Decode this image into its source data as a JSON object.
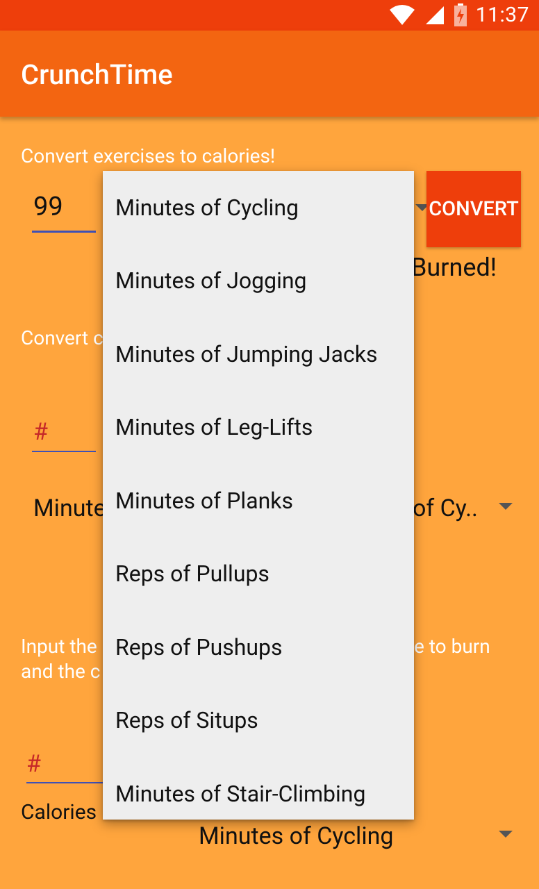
{
  "status": {
    "time": "11:37"
  },
  "app": {
    "title": "CrunchTime"
  },
  "section1": {
    "heading": "Convert exercises to calories!",
    "quantity_value": "99",
    "convert_label": "CONVERT",
    "result_partial": "Burned!"
  },
  "section2": {
    "heading_partial": "Convert c",
    "quantity_hint": "#",
    "spinner_left_partial": "Minute",
    "spinner_right_partial": "of Cy.."
  },
  "section3": {
    "line1_left": "Input the",
    "line1_right": "e to burn",
    "line2_left": "and the c",
    "quantity_hint": "#",
    "calories_label_partial": "Calories",
    "spinner_value": "Minutes of Cycling"
  },
  "dropdown": {
    "items": [
      "Minutes of Cycling",
      "Minutes of Jogging",
      "Minutes of Jumping Jacks",
      "Minutes of Leg-Lifts",
      "Minutes of Planks",
      "Reps of Pullups",
      "Reps of Pushups",
      "Reps of Situps",
      "Minutes of Stair-Climbing"
    ]
  },
  "colors": {
    "background": "#FFA53D",
    "statusbar": "#EE3E0B",
    "appbar": "#F36511",
    "button": "#EE3E0B",
    "underline": "#3F51B5",
    "hint": "#C62828",
    "dropdown_bg": "#EEEEEE"
  },
  "icons": [
    "wifi-icon",
    "signal-icon",
    "battery-charging-icon",
    "spinner-caret-icon"
  ]
}
